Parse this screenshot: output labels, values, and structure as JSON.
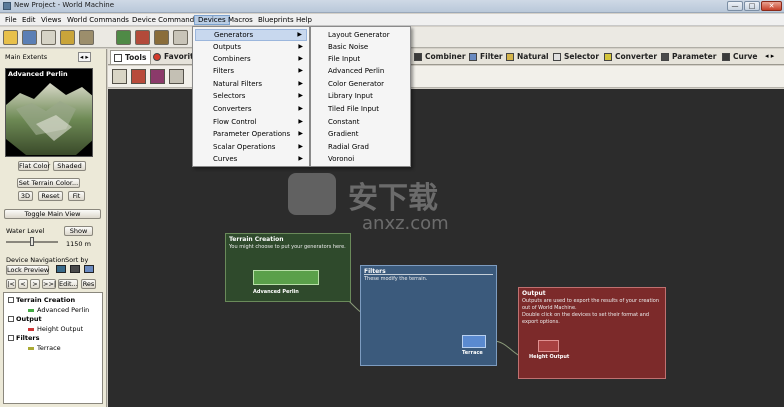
{
  "window": {
    "title": "New Project - World Machine",
    "minimize": "—",
    "maximize": "□",
    "close": "✕"
  },
  "menubar": [
    "File",
    "Edit",
    "Views",
    "World Commands",
    "Device Commands",
    "Devices",
    "Macros",
    "Blueprints",
    "Help"
  ],
  "tabs": {
    "tools": "Tools",
    "favorites": "Favorite",
    "combiner": "Combiner",
    "filter": "Filter",
    "natural": "Natural",
    "selector": "Selector",
    "converter": "Converter",
    "parameter": "Parameter",
    "curve": "Curve"
  },
  "devices_menu": [
    "Generators",
    "Outputs",
    "Combiners",
    "Filters",
    "Natural Filters",
    "Selectors",
    "Converters",
    "Flow Control",
    "Parameter Operations",
    "Scalar Operations",
    "Curves"
  ],
  "generators_menu": [
    "Layout Generator",
    "Basic Noise",
    "File Input",
    "Advanced Perlin",
    "Color Generator",
    "Library Input",
    "Tiled File Input",
    "Constant",
    "Gradient",
    "Radial Grad",
    "Voronoi"
  ],
  "left_panel": {
    "main_extents": "Main Extents",
    "preview_title": "Advanced Perlin",
    "flat_color": "Flat Color",
    "shaded": "Shaded",
    "set_terrain_color": "Set Terrain Color...",
    "btn_3d": "3D",
    "btn_reset": "Reset",
    "btn_fit": "Fit",
    "toggle_main_view": "Toggle Main View",
    "water_level": "Water Level",
    "show": "Show",
    "water_value": "1150 m",
    "device_navigation": "Device Navigation",
    "sort_by": "Sort by",
    "lock_preview": "Lock Preview",
    "nav_first": "|<",
    "nav_prev": "<",
    "nav_next": ">",
    "nav_last": ">>|",
    "edit": "Edit...",
    "res": "Res"
  },
  "tree": [
    {
      "label": "Terrain Creation",
      "group": true
    },
    {
      "label": "Advanced Perlin",
      "group": false,
      "color": "#44aa44"
    },
    {
      "label": "Output",
      "group": true
    },
    {
      "label": "Height Output",
      "group": false,
      "color": "#cc3333"
    },
    {
      "label": "Filters",
      "group": true
    },
    {
      "label": "Terrace",
      "group": false,
      "color": "#aaaa33"
    }
  ],
  "groups": {
    "terrain": {
      "title": "Terrain Creation",
      "desc": "You might choose to put your generators here.",
      "node": "Advanced Perlin",
      "color": "#2f4a2c"
    },
    "filters": {
      "title": "Filters",
      "desc": "These modify the terrain.",
      "node": "Terrace",
      "color": "#3b5a7c"
    },
    "output": {
      "title": "Output",
      "desc": "Outputs are used to export the results of your creation out of World Machine.",
      "desc2": "Double click on the devices to set their format and export options.",
      "node": "Height Output",
      "color": "#7c2a2a"
    }
  },
  "watermark": {
    "cn": "安下载",
    "domain": "anxz.com"
  }
}
